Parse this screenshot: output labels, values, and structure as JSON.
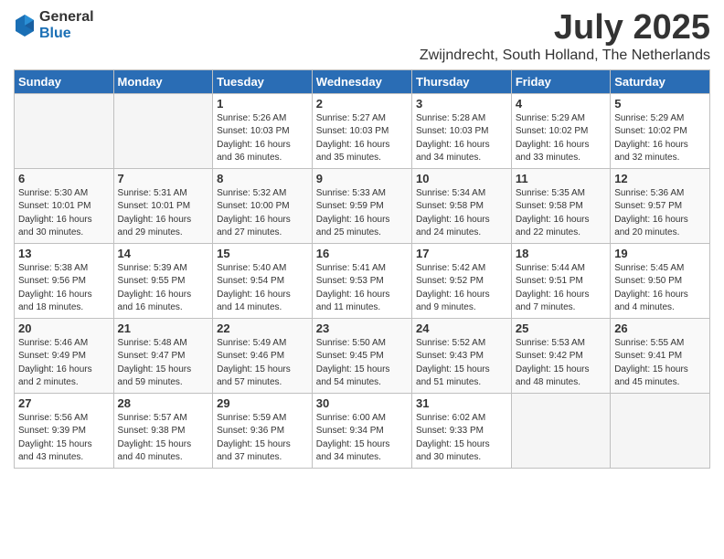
{
  "header": {
    "logo_general": "General",
    "logo_blue": "Blue",
    "month_title": "July 2025",
    "location": "Zwijndrecht, South Holland, The Netherlands"
  },
  "weekdays": [
    "Sunday",
    "Monday",
    "Tuesday",
    "Wednesday",
    "Thursday",
    "Friday",
    "Saturday"
  ],
  "weeks": [
    [
      {
        "day": "",
        "info": ""
      },
      {
        "day": "",
        "info": ""
      },
      {
        "day": "1",
        "info": "Sunrise: 5:26 AM\nSunset: 10:03 PM\nDaylight: 16 hours\nand 36 minutes."
      },
      {
        "day": "2",
        "info": "Sunrise: 5:27 AM\nSunset: 10:03 PM\nDaylight: 16 hours\nand 35 minutes."
      },
      {
        "day": "3",
        "info": "Sunrise: 5:28 AM\nSunset: 10:03 PM\nDaylight: 16 hours\nand 34 minutes."
      },
      {
        "day": "4",
        "info": "Sunrise: 5:29 AM\nSunset: 10:02 PM\nDaylight: 16 hours\nand 33 minutes."
      },
      {
        "day": "5",
        "info": "Sunrise: 5:29 AM\nSunset: 10:02 PM\nDaylight: 16 hours\nand 32 minutes."
      }
    ],
    [
      {
        "day": "6",
        "info": "Sunrise: 5:30 AM\nSunset: 10:01 PM\nDaylight: 16 hours\nand 30 minutes."
      },
      {
        "day": "7",
        "info": "Sunrise: 5:31 AM\nSunset: 10:01 PM\nDaylight: 16 hours\nand 29 minutes."
      },
      {
        "day": "8",
        "info": "Sunrise: 5:32 AM\nSunset: 10:00 PM\nDaylight: 16 hours\nand 27 minutes."
      },
      {
        "day": "9",
        "info": "Sunrise: 5:33 AM\nSunset: 9:59 PM\nDaylight: 16 hours\nand 25 minutes."
      },
      {
        "day": "10",
        "info": "Sunrise: 5:34 AM\nSunset: 9:58 PM\nDaylight: 16 hours\nand 24 minutes."
      },
      {
        "day": "11",
        "info": "Sunrise: 5:35 AM\nSunset: 9:58 PM\nDaylight: 16 hours\nand 22 minutes."
      },
      {
        "day": "12",
        "info": "Sunrise: 5:36 AM\nSunset: 9:57 PM\nDaylight: 16 hours\nand 20 minutes."
      }
    ],
    [
      {
        "day": "13",
        "info": "Sunrise: 5:38 AM\nSunset: 9:56 PM\nDaylight: 16 hours\nand 18 minutes."
      },
      {
        "day": "14",
        "info": "Sunrise: 5:39 AM\nSunset: 9:55 PM\nDaylight: 16 hours\nand 16 minutes."
      },
      {
        "day": "15",
        "info": "Sunrise: 5:40 AM\nSunset: 9:54 PM\nDaylight: 16 hours\nand 14 minutes."
      },
      {
        "day": "16",
        "info": "Sunrise: 5:41 AM\nSunset: 9:53 PM\nDaylight: 16 hours\nand 11 minutes."
      },
      {
        "day": "17",
        "info": "Sunrise: 5:42 AM\nSunset: 9:52 PM\nDaylight: 16 hours\nand 9 minutes."
      },
      {
        "day": "18",
        "info": "Sunrise: 5:44 AM\nSunset: 9:51 PM\nDaylight: 16 hours\nand 7 minutes."
      },
      {
        "day": "19",
        "info": "Sunrise: 5:45 AM\nSunset: 9:50 PM\nDaylight: 16 hours\nand 4 minutes."
      }
    ],
    [
      {
        "day": "20",
        "info": "Sunrise: 5:46 AM\nSunset: 9:49 PM\nDaylight: 16 hours\nand 2 minutes."
      },
      {
        "day": "21",
        "info": "Sunrise: 5:48 AM\nSunset: 9:47 PM\nDaylight: 15 hours\nand 59 minutes."
      },
      {
        "day": "22",
        "info": "Sunrise: 5:49 AM\nSunset: 9:46 PM\nDaylight: 15 hours\nand 57 minutes."
      },
      {
        "day": "23",
        "info": "Sunrise: 5:50 AM\nSunset: 9:45 PM\nDaylight: 15 hours\nand 54 minutes."
      },
      {
        "day": "24",
        "info": "Sunrise: 5:52 AM\nSunset: 9:43 PM\nDaylight: 15 hours\nand 51 minutes."
      },
      {
        "day": "25",
        "info": "Sunrise: 5:53 AM\nSunset: 9:42 PM\nDaylight: 15 hours\nand 48 minutes."
      },
      {
        "day": "26",
        "info": "Sunrise: 5:55 AM\nSunset: 9:41 PM\nDaylight: 15 hours\nand 45 minutes."
      }
    ],
    [
      {
        "day": "27",
        "info": "Sunrise: 5:56 AM\nSunset: 9:39 PM\nDaylight: 15 hours\nand 43 minutes."
      },
      {
        "day": "28",
        "info": "Sunrise: 5:57 AM\nSunset: 9:38 PM\nDaylight: 15 hours\nand 40 minutes."
      },
      {
        "day": "29",
        "info": "Sunrise: 5:59 AM\nSunset: 9:36 PM\nDaylight: 15 hours\nand 37 minutes."
      },
      {
        "day": "30",
        "info": "Sunrise: 6:00 AM\nSunset: 9:34 PM\nDaylight: 15 hours\nand 34 minutes."
      },
      {
        "day": "31",
        "info": "Sunrise: 6:02 AM\nSunset: 9:33 PM\nDaylight: 15 hours\nand 30 minutes."
      },
      {
        "day": "",
        "info": ""
      },
      {
        "day": "",
        "info": ""
      }
    ]
  ]
}
